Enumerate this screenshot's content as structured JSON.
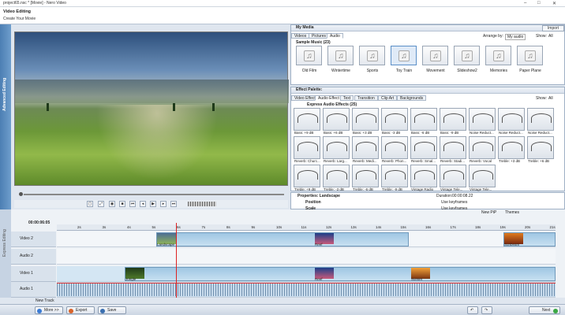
{
  "window": {
    "title": "project65.nsc * [Movie] - Nero Video",
    "controls": [
      "–",
      "□",
      "✕"
    ]
  },
  "header": {
    "title": "Video Editing",
    "subtitle": "Create Your Movie"
  },
  "side": {
    "advanced": "Advanced Editing",
    "express": "Express Editing"
  },
  "preview": {
    "timecode": ""
  },
  "media": {
    "title": "My Media",
    "import": "Import",
    "tabs": [
      "Videos",
      "Pictures",
      "Audio"
    ],
    "arrange_label": "Arrange by:",
    "arrange_value": "My audio",
    "show_label": "Show:",
    "show_value": "All",
    "group": "Sample Music (23)",
    "items": [
      "Old Film",
      "Wintertime",
      "Sports",
      "Toy Train",
      "Movement",
      "Slideshow2",
      "Memories",
      "Paper Plane"
    ]
  },
  "effects": {
    "title": "Effect Palette:",
    "tabs": [
      "Video Effect",
      "Audio Effect",
      "Text",
      "Transition",
      "Clip Art",
      "Backgrounds"
    ],
    "show_label": "Show:",
    "show_value": "All",
    "group": "Express Audio Effects (25)",
    "rows": [
      [
        "Bass: +9 dB",
        "Bass: +6 dB",
        "Bass: +3 dB",
        "Bass: -3 dB",
        "Bass: -6 dB",
        "Bass: -9 dB",
        "Noise Reduct...",
        "Noise Reduct...",
        "Noise Reduct..."
      ],
      [
        "Reverb: Churc...",
        "Reverb: Larg...",
        "Reverb: Medi...",
        "Reverb: Phon...",
        "Reverb: Smal...",
        "Reverb: Stadi...",
        "Reverb: Vocal",
        "Treble: +3 dB",
        "Treble: +6 dB"
      ],
      [
        "Treble: +9 dB",
        "Treble: -3 dB",
        "Treble: -6 dB",
        "Treble: -9 dB",
        "Vintage Radio",
        "Vintage Tele...",
        "Vintage Tele...",
        "",
        ""
      ]
    ]
  },
  "properties": {
    "title": "Properties: Landscape",
    "duration_label": "Duration:",
    "duration": "00:00:08.22",
    "rows": [
      "Position",
      "Scale"
    ],
    "keyframes": [
      "Use keyframes",
      "Use keyframes"
    ]
  },
  "toolbar": {
    "new_pip": "New PiP",
    "themes": "Themes"
  },
  "timeline": {
    "time": "00:00:06:05",
    "ticks": [
      "2s",
      "3s",
      "4s",
      "5s",
      "6s",
      "7s",
      "8s",
      "9s",
      "10s",
      "11s",
      "12s",
      "13s",
      "14s",
      "15s",
      "16s",
      "17s",
      "18s",
      "19s",
      "20s",
      "21s"
    ],
    "tracks": [
      "Video 2",
      "Audio 2",
      "Video 1",
      "Audio 1"
    ],
    "clips": {
      "landscape": "Landscape",
      "reef": "Reef",
      "sunbeam": "Sunbeam",
      "jungle": "Jungle",
      "reef2": "Reef",
      "sunset": "Sunset"
    },
    "new_track": "New Track"
  },
  "footer": {
    "more": "More >>",
    "export": "Export",
    "save": "Save",
    "next": "Next"
  }
}
